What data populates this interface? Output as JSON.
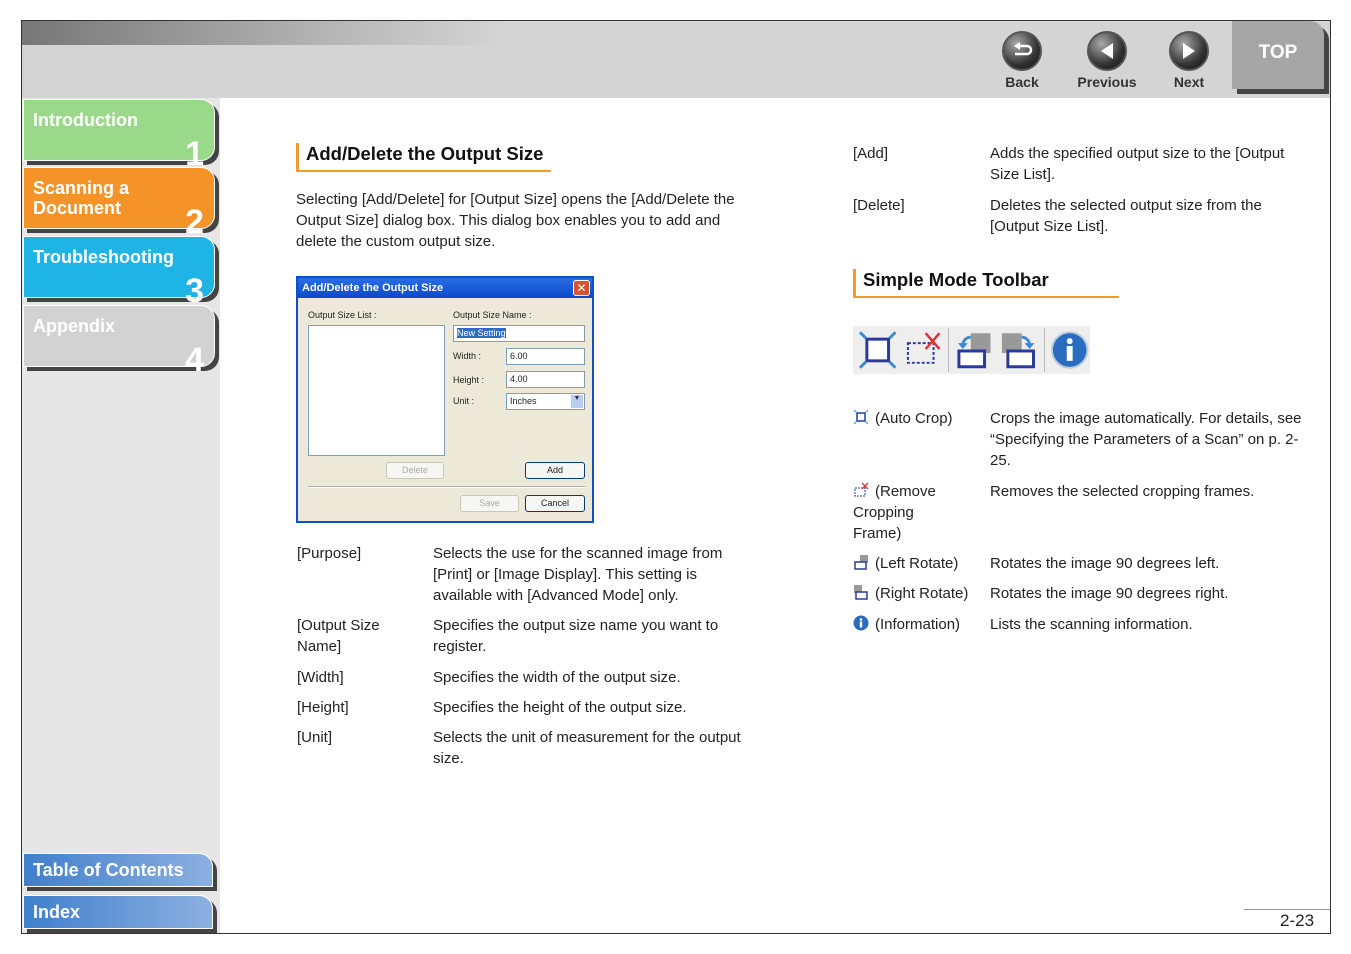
{
  "nav": {
    "back": "Back",
    "previous": "Previous",
    "next": "Next",
    "top": "TOP"
  },
  "sidebar": {
    "tabs": [
      {
        "label": "Introduction",
        "num": "1",
        "color": "#9ad98a"
      },
      {
        "label": "Scanning a Document",
        "num": "2",
        "color": "#f49328"
      },
      {
        "label": "Troubleshooting",
        "num": "3",
        "color": "#1fb4e6"
      },
      {
        "label": "Appendix",
        "num": "4",
        "color": "#d2d2d2"
      }
    ],
    "toc": "Table of Contents",
    "index": "Index"
  },
  "left": {
    "title": "Add/Delete the Output Size",
    "intro": "Selecting [Add/Delete] for [Output Size] opens the [Add/Delete the Output Size] dialog box. This dialog box enables you to add and delete the custom output size.",
    "dialog": {
      "title": "Add/Delete the Output Size",
      "list_label": "Output Size List :",
      "name_label": "Output Size Name :",
      "name_value": "New Setting",
      "width_label": "Width :",
      "width_value": "6.00",
      "height_label": "Height :",
      "height_value": "4.00",
      "unit_label": "Unit :",
      "unit_value": "Inches",
      "delete": "Delete",
      "add": "Add",
      "save": "Save",
      "cancel": "Cancel"
    },
    "defs": [
      {
        "term": "[Purpose]",
        "desc": "Selects the use for the scanned image from [Print] or [Image Display]. This setting is available with [Advanced Mode] only."
      },
      {
        "term": "[Output Size Name]",
        "desc": "Specifies the output size name you want to register."
      },
      {
        "term": "[Width]",
        "desc": "Specifies the width of the output size."
      },
      {
        "term": "[Height]",
        "desc": "Specifies the height of the output size."
      },
      {
        "term": "[Unit]",
        "desc": "Selects the unit of measurement for the output size."
      }
    ]
  },
  "right": {
    "defs": [
      {
        "term": "[Add]",
        "desc": "Adds the specified output size to the [Output Size List]."
      },
      {
        "term": "[Delete]",
        "desc": "Deletes the selected output size from the [Output Size List]."
      }
    ],
    "title": "Simple Mode Toolbar",
    "tools": [
      {
        "icon": "auto-crop",
        "term": "(Auto Crop)",
        "desc": "Crops the image automatically. For details, see “Specifying the Parameters of a Scan” on p. 2-25."
      },
      {
        "icon": "remove-cropping-frame",
        "term": "(Remove Cropping Frame)",
        "desc": "Removes the selected cropping frames."
      },
      {
        "icon": "left-rotate",
        "term": "(Left Rotate)",
        "desc": "Rotates the image 90 degrees left."
      },
      {
        "icon": "right-rotate",
        "term": "(Right Rotate)",
        "desc": "Rotates the image 90 degrees right."
      },
      {
        "icon": "information",
        "term": "(Information)",
        "desc": "Lists the scanning information."
      }
    ]
  },
  "page_number": "2-23"
}
